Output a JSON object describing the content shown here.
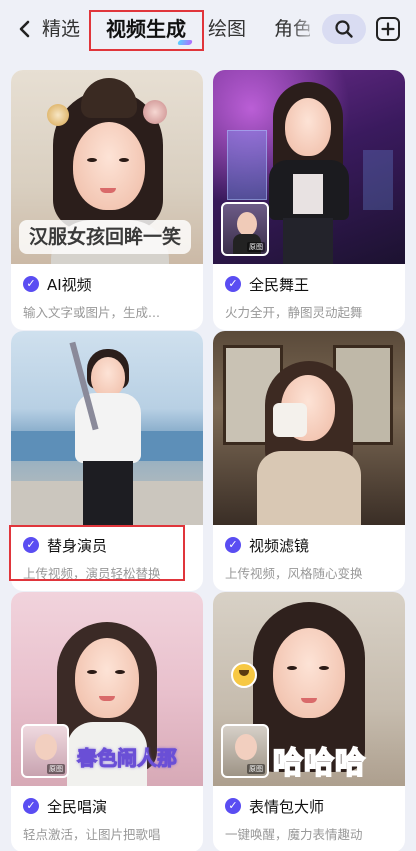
{
  "nav": {
    "back_icon": "chevron-left-icon",
    "tabs": [
      {
        "label": "精选"
      },
      {
        "label": "视频生成"
      },
      {
        "label": "绘图"
      },
      {
        "label": "角色"
      }
    ],
    "active_tab": "视频生成",
    "search_icon": "search-icon",
    "add_icon": "plus-square-icon"
  },
  "cards": [
    {
      "title": "AI视频",
      "desc": "输入文字或图片，生成...",
      "overlay": "汉服女孩回眸一笑",
      "verified": true
    },
    {
      "title": "全民舞王",
      "desc": "火力全开，静图灵动起舞",
      "ref_label": "原图",
      "verified": true
    },
    {
      "title": "替身演员",
      "desc": "上传视频，演员轻松替换",
      "verified": true
    },
    {
      "title": "视频滤镜",
      "desc": "上传视频，风格随心变换",
      "verified": true
    },
    {
      "title": "全民唱演",
      "desc": "轻点激活，让图片把歌唱",
      "ref_label": "原图",
      "overlay": "春色闹人那",
      "verified": true
    },
    {
      "title": "表情包大师",
      "desc": "一键唤醒，魔力表情趣动",
      "ref_label": "原图",
      "overlay": "哈哈哈",
      "verified": true
    }
  ],
  "colors": {
    "background": "#eef0f7",
    "accent": "#5a4df2",
    "highlight_box": "#e0353b"
  }
}
